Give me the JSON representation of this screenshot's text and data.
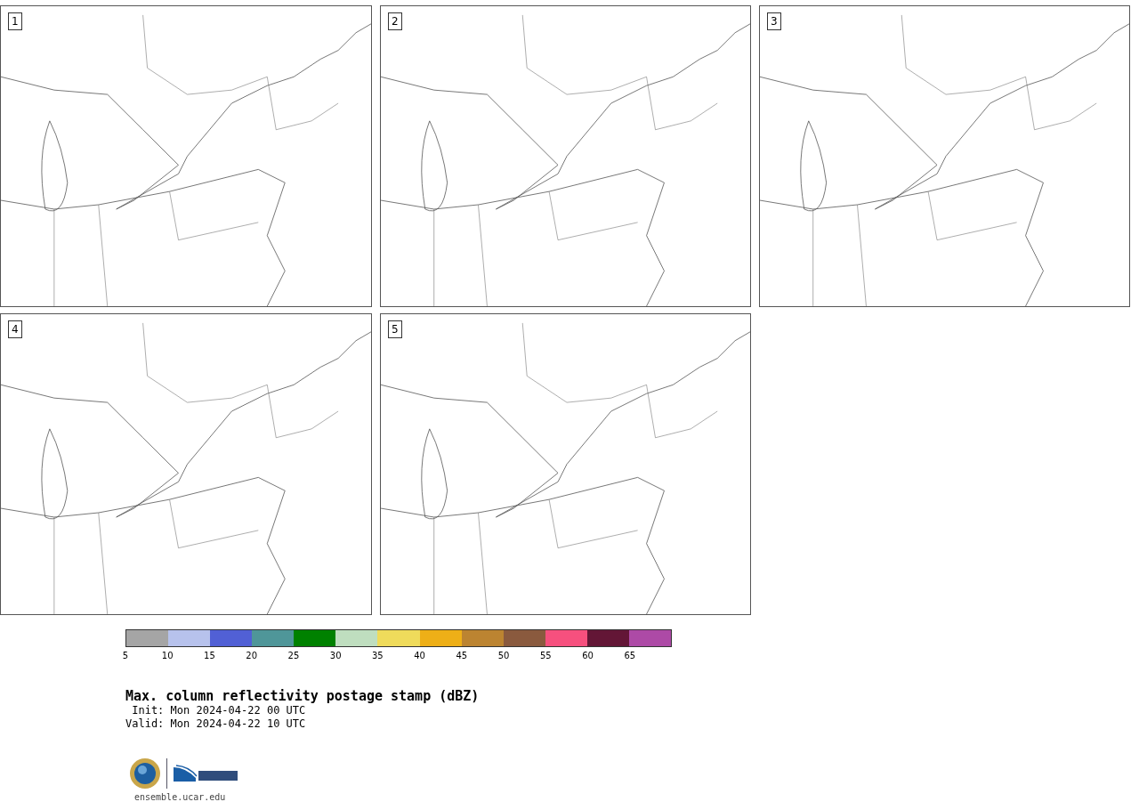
{
  "panels": [
    {
      "label": "1"
    },
    {
      "label": "2"
    },
    {
      "label": "3"
    },
    {
      "label": "4"
    },
    {
      "label": "5"
    }
  ],
  "colorbar": {
    "bins": [
      {
        "color": "#a5a5a5"
      },
      {
        "color": "#b7c2ec"
      },
      {
        "color": "#5160d5"
      },
      {
        "color": "#4f9699"
      },
      {
        "color": "#008100"
      },
      {
        "color": "#bfdebf"
      },
      {
        "color": "#efdb5b"
      },
      {
        "color": "#eeaf17"
      },
      {
        "color": "#bc8431"
      },
      {
        "color": "#8a5a3e"
      },
      {
        "color": "#f6507e"
      },
      {
        "color": "#631636"
      },
      {
        "color": "#ad4aa6"
      }
    ],
    "ticks": [
      "5",
      "10",
      "15",
      "20",
      "25",
      "30",
      "35",
      "40",
      "45",
      "50",
      "55",
      "60",
      "65"
    ]
  },
  "title": "Max. column reflectivity postage stamp (dBZ)",
  "init": " Init: Mon 2024-04-22 00 UTC",
  "valid": "Valid: Mon 2024-04-22 10 UTC",
  "footer_url": "ensemble.ucar.edu"
}
